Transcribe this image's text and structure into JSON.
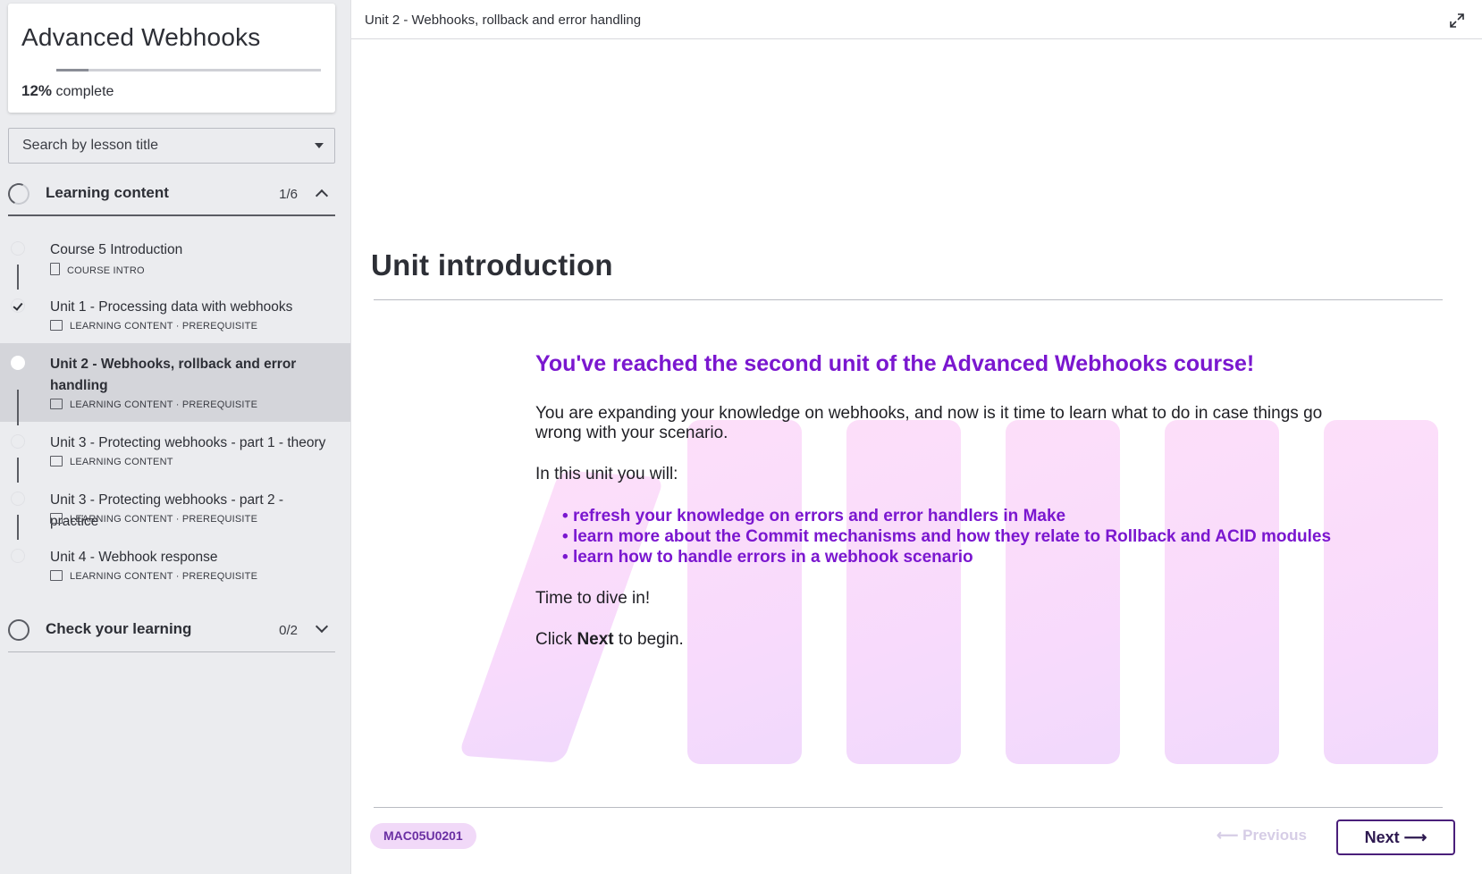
{
  "course": {
    "title": "Advanced Webhooks",
    "progress_percent": 12,
    "progress_value": "12%",
    "progress_suffix": "complete"
  },
  "search": {
    "placeholder": "Search by lesson title"
  },
  "sections": [
    {
      "label": "Learning content",
      "count": "1/6",
      "expanded": true
    },
    {
      "label": "Check your learning",
      "count": "0/2",
      "expanded": false
    }
  ],
  "lessons": [
    {
      "title": "Course 5 Introduction",
      "meta": "COURSE INTRO",
      "status": "not-started"
    },
    {
      "title": "Unit 1 - Processing data with webhooks",
      "meta": "LEARNING CONTENT · PREREQUISITE",
      "status": "completed"
    },
    {
      "title": "Unit 2 - Webhooks, rollback and error handling",
      "meta": "LEARNING CONTENT · PREREQUISITE",
      "status": "current"
    },
    {
      "title": "Unit 3 - Protecting webhooks - part 1 - theory",
      "meta": "LEARNING CONTENT",
      "status": "not-started"
    },
    {
      "title": "Unit 3 - Protecting webhooks - part 2 - practice",
      "meta": "LEARNING CONTENT · PREREQUISITE",
      "status": "not-started"
    },
    {
      "title": "Unit 4 - Webhook response",
      "meta": "LEARNING CONTENT · PREREQUISITE",
      "status": "not-started"
    }
  ],
  "main": {
    "topbar_title": "Unit 2 - Webhooks, rollback and error handling",
    "heading": "Unit introduction",
    "intro_heading": "You've reached the second unit of the Advanced Webhooks course!",
    "para1": "You are expanding your knowledge on webhooks, and now is it time to learn what to do in case things go wrong with your scenario.",
    "para2": "In this unit you will:",
    "bullets": [
      "refresh your knowledge on errors and error handlers in Make",
      "learn more about the Commit mechanisms and how they relate to Rollback and ACID modules",
      "learn how to handle errors in a webhook scenario"
    ],
    "para3": "Time to dive in!",
    "click_prefix": "Click ",
    "click_bold": "Next",
    "click_suffix": " to begin."
  },
  "footer": {
    "code": "MAC05U0201",
    "previous_label": "Previous",
    "next_label": "Next"
  },
  "colors": {
    "accent_purple": "#7a17cf",
    "deco_pink": "#f7d4fb"
  },
  "icons": {
    "expand": "expand-icon",
    "caret": "caret-down-icon",
    "progress_ring": "progress-ring-icon"
  }
}
